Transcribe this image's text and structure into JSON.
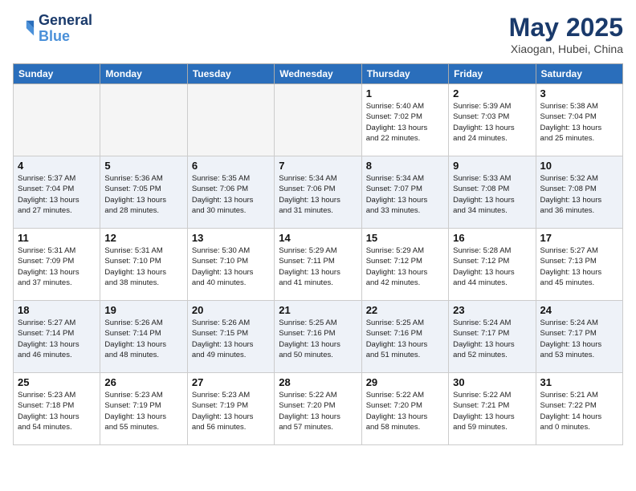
{
  "header": {
    "logo_line1": "General",
    "logo_line2": "Blue",
    "month": "May 2025",
    "location": "Xiaogan, Hubei, China"
  },
  "days_of_week": [
    "Sunday",
    "Monday",
    "Tuesday",
    "Wednesday",
    "Thursday",
    "Friday",
    "Saturday"
  ],
  "weeks": [
    [
      {
        "day": "",
        "info": "",
        "empty": true
      },
      {
        "day": "",
        "info": "",
        "empty": true
      },
      {
        "day": "",
        "info": "",
        "empty": true
      },
      {
        "day": "",
        "info": "",
        "empty": true
      },
      {
        "day": "1",
        "info": "Sunrise: 5:40 AM\nSunset: 7:02 PM\nDaylight: 13 hours\nand 22 minutes.",
        "empty": false
      },
      {
        "day": "2",
        "info": "Sunrise: 5:39 AM\nSunset: 7:03 PM\nDaylight: 13 hours\nand 24 minutes.",
        "empty": false
      },
      {
        "day": "3",
        "info": "Sunrise: 5:38 AM\nSunset: 7:04 PM\nDaylight: 13 hours\nand 25 minutes.",
        "empty": false
      }
    ],
    [
      {
        "day": "4",
        "info": "Sunrise: 5:37 AM\nSunset: 7:04 PM\nDaylight: 13 hours\nand 27 minutes.",
        "empty": false
      },
      {
        "day": "5",
        "info": "Sunrise: 5:36 AM\nSunset: 7:05 PM\nDaylight: 13 hours\nand 28 minutes.",
        "empty": false
      },
      {
        "day": "6",
        "info": "Sunrise: 5:35 AM\nSunset: 7:06 PM\nDaylight: 13 hours\nand 30 minutes.",
        "empty": false
      },
      {
        "day": "7",
        "info": "Sunrise: 5:34 AM\nSunset: 7:06 PM\nDaylight: 13 hours\nand 31 minutes.",
        "empty": false
      },
      {
        "day": "8",
        "info": "Sunrise: 5:34 AM\nSunset: 7:07 PM\nDaylight: 13 hours\nand 33 minutes.",
        "empty": false
      },
      {
        "day": "9",
        "info": "Sunrise: 5:33 AM\nSunset: 7:08 PM\nDaylight: 13 hours\nand 34 minutes.",
        "empty": false
      },
      {
        "day": "10",
        "info": "Sunrise: 5:32 AM\nSunset: 7:08 PM\nDaylight: 13 hours\nand 36 minutes.",
        "empty": false
      }
    ],
    [
      {
        "day": "11",
        "info": "Sunrise: 5:31 AM\nSunset: 7:09 PM\nDaylight: 13 hours\nand 37 minutes.",
        "empty": false
      },
      {
        "day": "12",
        "info": "Sunrise: 5:31 AM\nSunset: 7:10 PM\nDaylight: 13 hours\nand 38 minutes.",
        "empty": false
      },
      {
        "day": "13",
        "info": "Sunrise: 5:30 AM\nSunset: 7:10 PM\nDaylight: 13 hours\nand 40 minutes.",
        "empty": false
      },
      {
        "day": "14",
        "info": "Sunrise: 5:29 AM\nSunset: 7:11 PM\nDaylight: 13 hours\nand 41 minutes.",
        "empty": false
      },
      {
        "day": "15",
        "info": "Sunrise: 5:29 AM\nSunset: 7:12 PM\nDaylight: 13 hours\nand 42 minutes.",
        "empty": false
      },
      {
        "day": "16",
        "info": "Sunrise: 5:28 AM\nSunset: 7:12 PM\nDaylight: 13 hours\nand 44 minutes.",
        "empty": false
      },
      {
        "day": "17",
        "info": "Sunrise: 5:27 AM\nSunset: 7:13 PM\nDaylight: 13 hours\nand 45 minutes.",
        "empty": false
      }
    ],
    [
      {
        "day": "18",
        "info": "Sunrise: 5:27 AM\nSunset: 7:14 PM\nDaylight: 13 hours\nand 46 minutes.",
        "empty": false
      },
      {
        "day": "19",
        "info": "Sunrise: 5:26 AM\nSunset: 7:14 PM\nDaylight: 13 hours\nand 48 minutes.",
        "empty": false
      },
      {
        "day": "20",
        "info": "Sunrise: 5:26 AM\nSunset: 7:15 PM\nDaylight: 13 hours\nand 49 minutes.",
        "empty": false
      },
      {
        "day": "21",
        "info": "Sunrise: 5:25 AM\nSunset: 7:16 PM\nDaylight: 13 hours\nand 50 minutes.",
        "empty": false
      },
      {
        "day": "22",
        "info": "Sunrise: 5:25 AM\nSunset: 7:16 PM\nDaylight: 13 hours\nand 51 minutes.",
        "empty": false
      },
      {
        "day": "23",
        "info": "Sunrise: 5:24 AM\nSunset: 7:17 PM\nDaylight: 13 hours\nand 52 minutes.",
        "empty": false
      },
      {
        "day": "24",
        "info": "Sunrise: 5:24 AM\nSunset: 7:17 PM\nDaylight: 13 hours\nand 53 minutes.",
        "empty": false
      }
    ],
    [
      {
        "day": "25",
        "info": "Sunrise: 5:23 AM\nSunset: 7:18 PM\nDaylight: 13 hours\nand 54 minutes.",
        "empty": false
      },
      {
        "day": "26",
        "info": "Sunrise: 5:23 AM\nSunset: 7:19 PM\nDaylight: 13 hours\nand 55 minutes.",
        "empty": false
      },
      {
        "day": "27",
        "info": "Sunrise: 5:23 AM\nSunset: 7:19 PM\nDaylight: 13 hours\nand 56 minutes.",
        "empty": false
      },
      {
        "day": "28",
        "info": "Sunrise: 5:22 AM\nSunset: 7:20 PM\nDaylight: 13 hours\nand 57 minutes.",
        "empty": false
      },
      {
        "day": "29",
        "info": "Sunrise: 5:22 AM\nSunset: 7:20 PM\nDaylight: 13 hours\nand 58 minutes.",
        "empty": false
      },
      {
        "day": "30",
        "info": "Sunrise: 5:22 AM\nSunset: 7:21 PM\nDaylight: 13 hours\nand 59 minutes.",
        "empty": false
      },
      {
        "day": "31",
        "info": "Sunrise: 5:21 AM\nSunset: 7:22 PM\nDaylight: 14 hours\nand 0 minutes.",
        "empty": false
      }
    ]
  ]
}
